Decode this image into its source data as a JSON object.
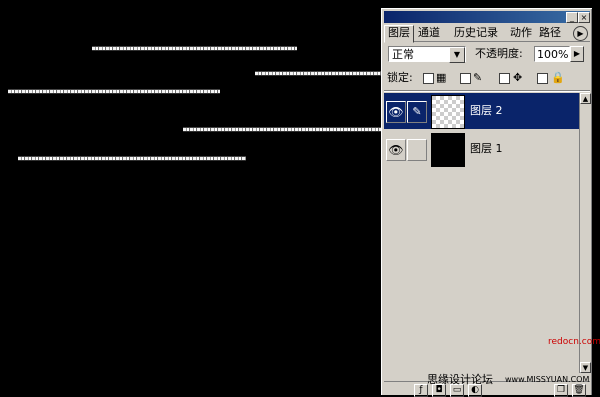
{
  "panel": {
    "title_buttons": [
      "_",
      "×"
    ],
    "tabs": [
      "图层",
      "通道",
      "历史记录",
      "动作",
      "路径"
    ],
    "tab_arrow": "▶",
    "blend_mode": "正常",
    "opacity_label": "不透明度:",
    "opacity_value": "100%",
    "lock_label": "锁定:",
    "layers": [
      {
        "name": "图层 2",
        "selected": true,
        "thumbnail": "transparent"
      },
      {
        "name": "图层 1",
        "selected": false,
        "thumbnail": "black"
      }
    ],
    "bottom_icons": [
      "layer-style-icon",
      "mask-icon",
      "new-set-icon",
      "adjustment-icon",
      "new-layer-icon",
      "trash-icon"
    ]
  },
  "watermark": {
    "site": "redocn.com",
    "forum": "思缘设计论坛",
    "forum_url": "www.MISSYUAN.COM"
  },
  "colors": {
    "canvas": "#000000",
    "panel_bg": "#d4d0c8",
    "selection": "#0a246a",
    "titlebar": "#0a246a"
  }
}
